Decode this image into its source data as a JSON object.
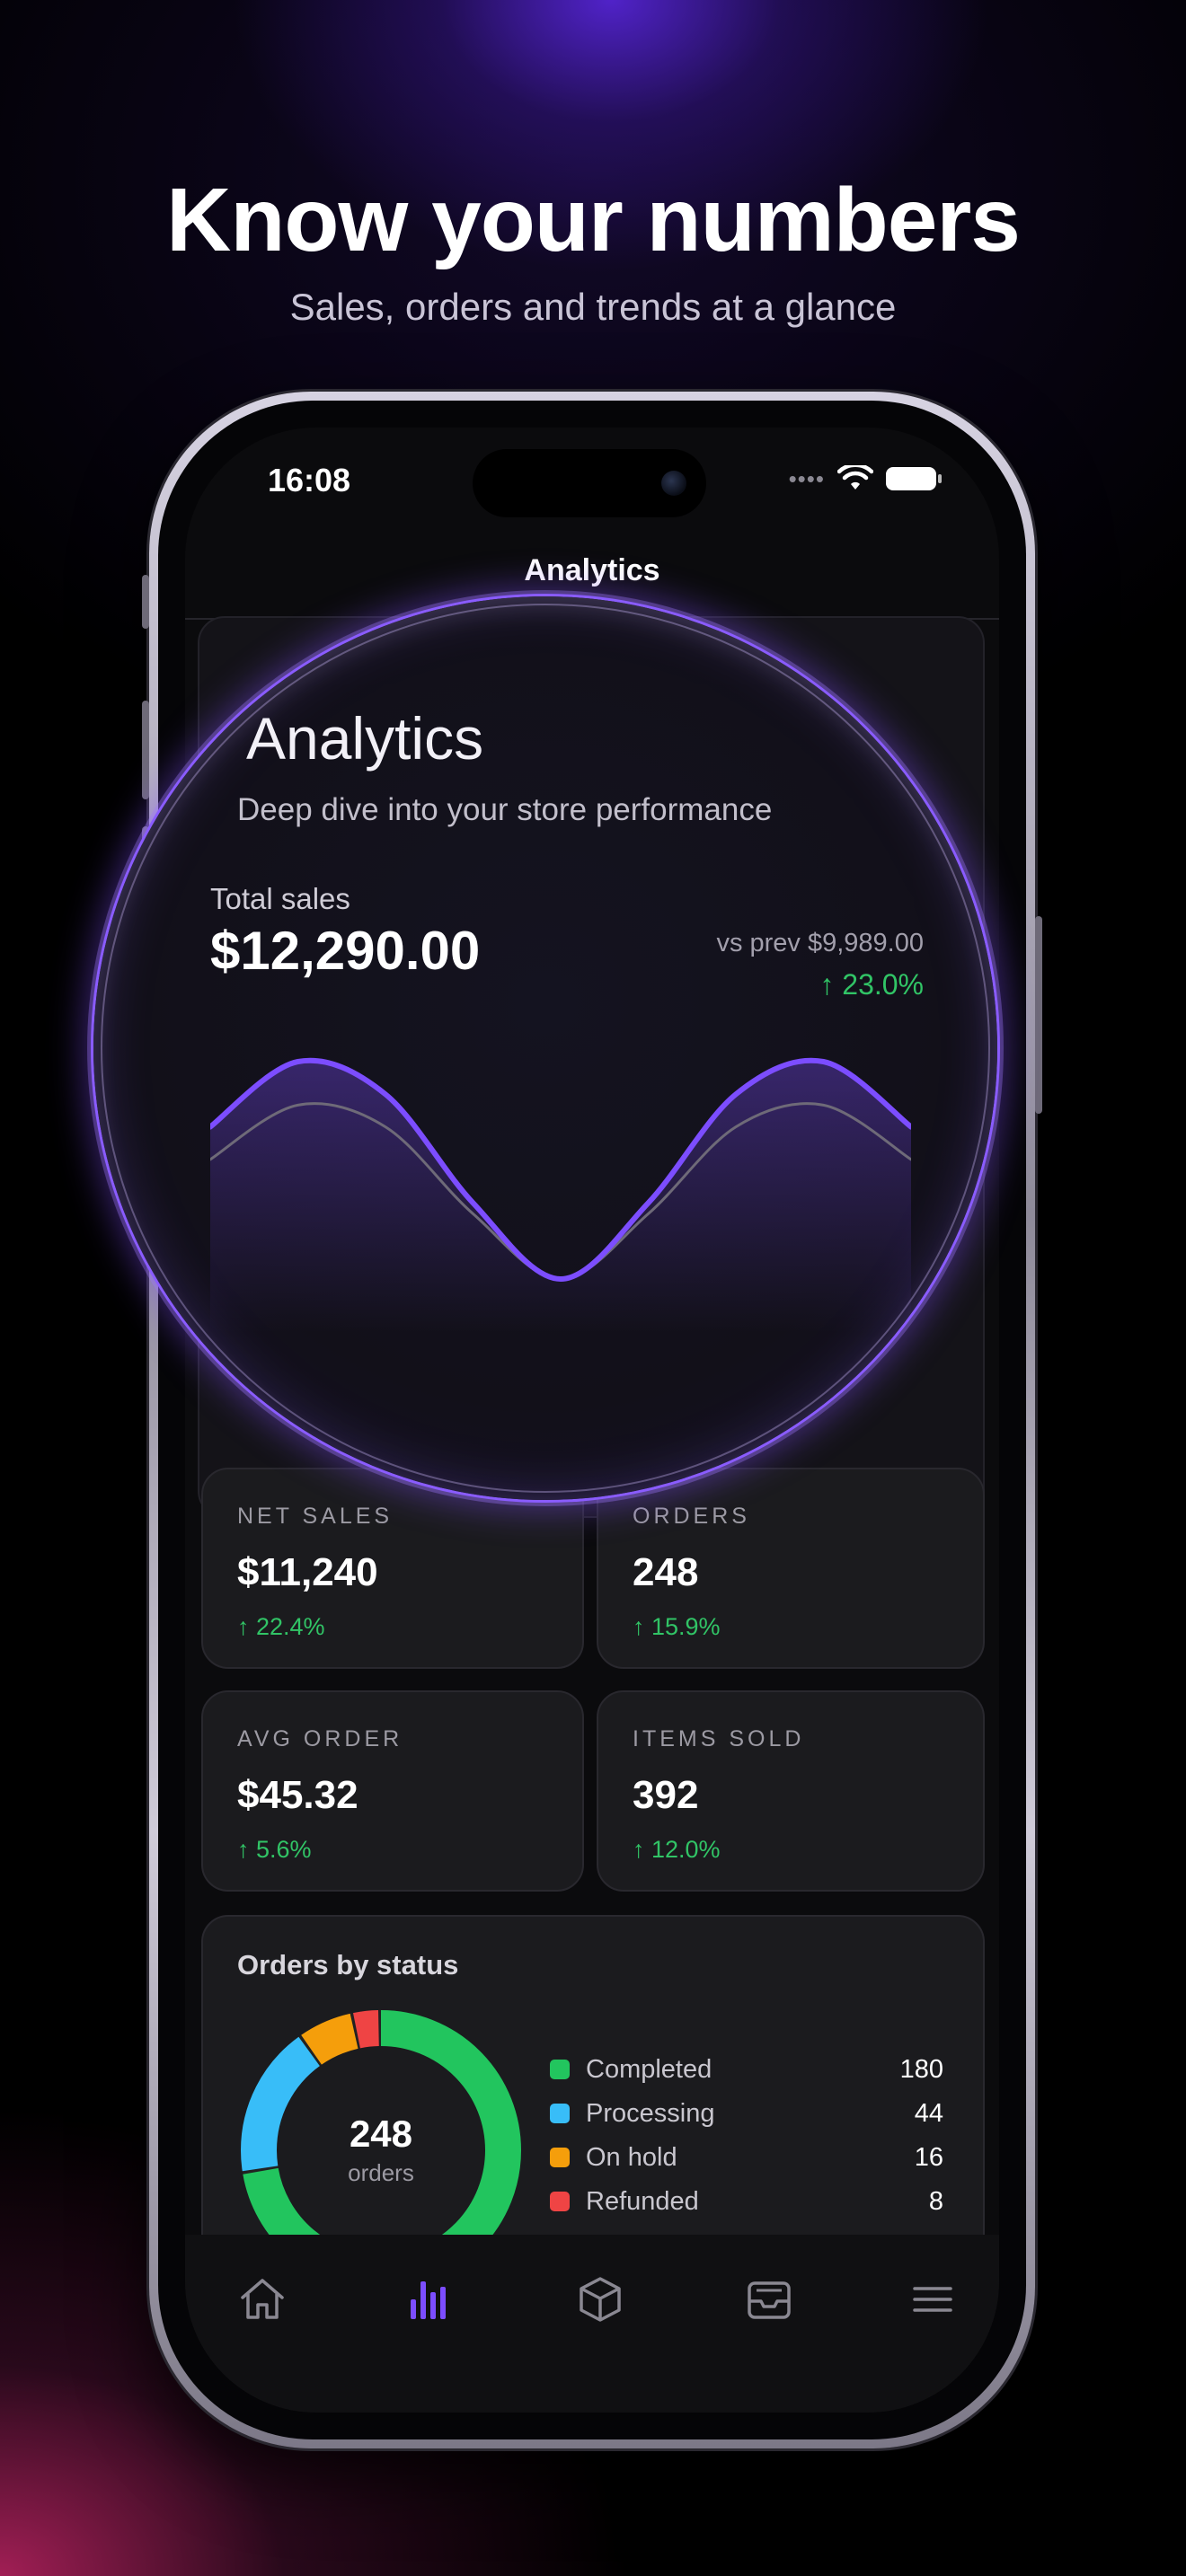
{
  "promo": {
    "headline": "Know your numbers",
    "subheadline": "Sales, orders and trends at a glance"
  },
  "status_bar": {
    "time": "16:08",
    "icons": [
      "signal-dots-icon",
      "wifi-icon",
      "battery-icon"
    ]
  },
  "nav": {
    "title": "Analytics"
  },
  "hero": {
    "title": "Analytics",
    "subtitle": "Deep dive into your store performance",
    "total_label": "Total sales",
    "total_value": "$12,290.00",
    "prev_label": "vs prev $9,989.00",
    "delta": "↑ 23.0%"
  },
  "stats": [
    {
      "label": "NET SALES",
      "value": "$11,240",
      "delta": "↑ 22.4%"
    },
    {
      "label": "ORDERS",
      "value": "248",
      "delta": "↑ 15.9%"
    },
    {
      "label": "AVG ORDER",
      "value": "$45.32",
      "delta": "↑ 5.6%"
    },
    {
      "label": "ITEMS SOLD",
      "value": "392",
      "delta": "↑ 12.0%"
    }
  ],
  "orders_by_status": {
    "title": "Orders by status",
    "center_value": "248",
    "center_label": "orders",
    "items": [
      {
        "label": "Completed",
        "value": "180",
        "color": "#22c55e"
      },
      {
        "label": "Processing",
        "value": "44",
        "color": "#38bdf8"
      },
      {
        "label": "On hold",
        "value": "16",
        "color": "#f59e0b"
      },
      {
        "label": "Refunded",
        "value": "8",
        "color": "#ef4444"
      }
    ]
  },
  "tabbar": {
    "tabs": [
      {
        "icon": "home-icon",
        "active": false
      },
      {
        "icon": "analytics-icon",
        "active": true
      },
      {
        "icon": "box-icon",
        "active": false
      },
      {
        "icon": "inbox-icon",
        "active": false
      },
      {
        "icon": "menu-icon",
        "active": false
      }
    ]
  },
  "colors": {
    "accent": "#7c4dff",
    "positive": "#31c466",
    "background": "#0b0b0d",
    "card": "#1b1b1e"
  },
  "chart_data": {
    "type": "line",
    "title": "",
    "xlabel": "",
    "ylabel": "",
    "x": [
      0,
      1,
      2,
      3,
      4,
      5,
      6,
      7,
      8
    ],
    "series": [
      {
        "values": [
          0.7,
          1.0,
          0.85,
          0.35,
          0.0,
          0.35,
          0.85,
          1.0,
          0.7
        ],
        "color": "#7c4dff"
      },
      {
        "values": [
          0.55,
          0.8,
          0.7,
          0.3,
          0.0,
          0.3,
          0.7,
          0.8,
          0.55
        ],
        "color": "#6e6a78"
      }
    ],
    "grid": false,
    "legend": "none"
  }
}
